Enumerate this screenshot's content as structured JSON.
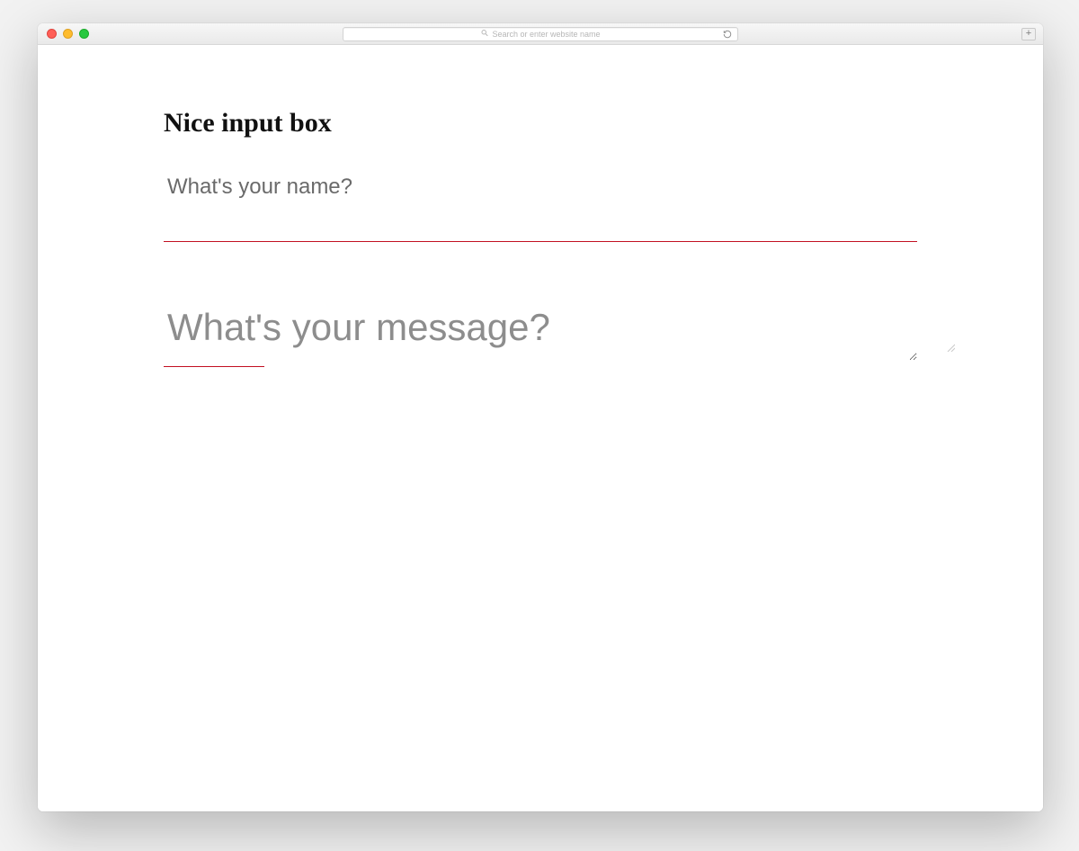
{
  "browser": {
    "address_placeholder": "Search or enter website name"
  },
  "page": {
    "title": "Nice input box",
    "name_placeholder": "What's your name?",
    "message_placeholder": "What's your message?",
    "name_value": "",
    "message_value": ""
  },
  "colors": {
    "accent": "#c21022"
  }
}
